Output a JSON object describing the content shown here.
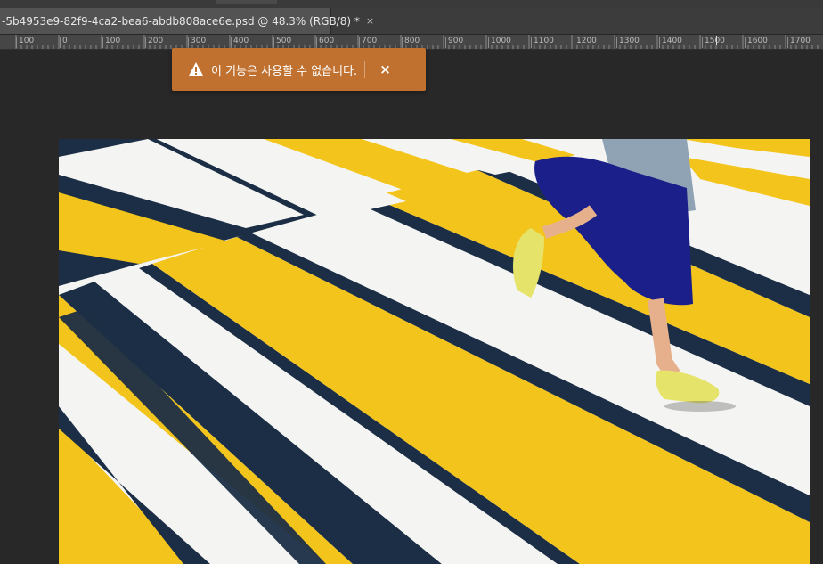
{
  "document_tab": {
    "title": "-5b4953e9-82f9-4ca2-bea6-abdb808ace6e.psd @ 48.3% (RGB/8) *",
    "close_glyph": "×"
  },
  "ruler": {
    "labels": [
      "100",
      "0",
      "100",
      "200",
      "300",
      "400",
      "500",
      "600",
      "700",
      "800",
      "900",
      "1000",
      "1100",
      "1200",
      "1300",
      "1400",
      "1500",
      "1600",
      "1700"
    ]
  },
  "toast": {
    "icon": "warning-icon",
    "message": "이 기능은 사용할 수 없습니다.",
    "close_glyph": "×",
    "color": "#c1712f"
  },
  "canvas": {
    "background": "#282828",
    "image": {
      "description_icon": "crosswalk-runner-photo",
      "stripe_yellow": "#f3c51c",
      "stripe_navy": "#1b2e45"
    }
  }
}
